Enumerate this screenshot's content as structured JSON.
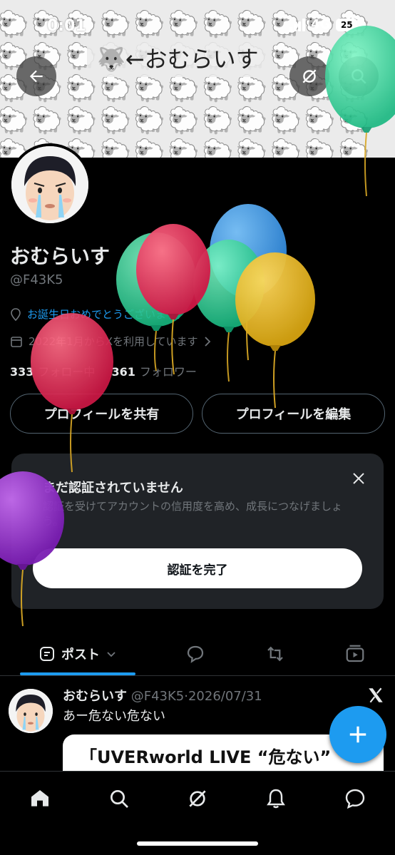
{
  "status_bar": {
    "time": "0:01",
    "network": "4G",
    "battery": "25"
  },
  "banner": {
    "title": "🐺←おむらいす",
    "sheep_emoji": "🐑"
  },
  "profile": {
    "name": "おむらいす",
    "handle": "@F43K5",
    "birthday_text": "お誕生日おめでとうございます。",
    "joined_text": "2022年1月からXを利用しています",
    "following_count": "333",
    "following_label": "フォロー中",
    "followers_count": "361",
    "followers_label": "フォロワー",
    "share_button": "プロフィールを共有",
    "edit_button": "プロフィールを編集"
  },
  "verify_card": {
    "title": "まだ認証されていません",
    "description": "認証を受けてアカウントの信用度を高め、成長につなげましょう。",
    "button": "認証を完了"
  },
  "tabs": {
    "posts_label": "ポスト"
  },
  "post": {
    "author": "おむらいす",
    "handle_date": "@F43K5·2026/07/31",
    "text": "あー危ない危ない",
    "quote_preview": "「UVERworld LIVE “危ない”"
  },
  "colors": {
    "accent": "#1d9bf0",
    "background": "#000000",
    "card": "#202327",
    "muted": "#71767b"
  },
  "icons": [
    "back-arrow-icon",
    "grok-icon",
    "search-icon",
    "location-icon",
    "calendar-icon",
    "chevron-right-icon",
    "close-icon",
    "chevron-down-icon",
    "reply-icon",
    "repost-icon",
    "media-icon",
    "x-logo-icon",
    "plus-icon",
    "home-icon",
    "notifications-icon",
    "messages-icon"
  ]
}
